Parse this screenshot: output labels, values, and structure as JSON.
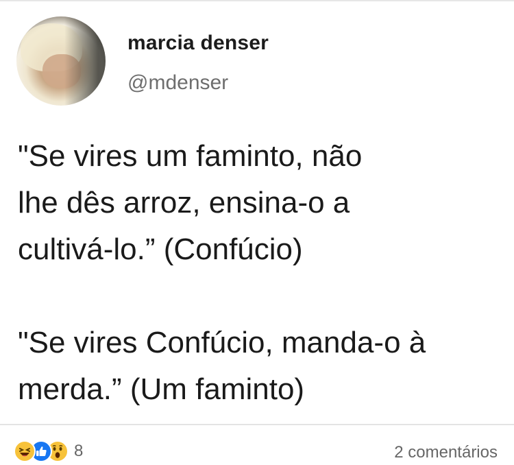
{
  "post": {
    "author": {
      "display_name": "marcia denser",
      "handle": "@mdenser"
    },
    "paragraphs": [
      {
        "lines": [
          "\"Se vires um faminto, não",
          "lhe dês arroz, ensina-o a",
          "cultivá-lo.”  (Confúcio)"
        ]
      },
      {
        "lines": [
          "\"Se vires Confúcio, manda-o à",
          "merda.”  (Um faminto)"
        ]
      }
    ]
  },
  "footer": {
    "reactions": [
      "haha-icon",
      "like-icon",
      "wow-icon"
    ],
    "reaction_count": "8",
    "comments_label": "2 comentários"
  },
  "colors": {
    "like_blue": "#1877f2",
    "emoji_yellow": "#f7c23a",
    "muted_text": "#666666"
  }
}
